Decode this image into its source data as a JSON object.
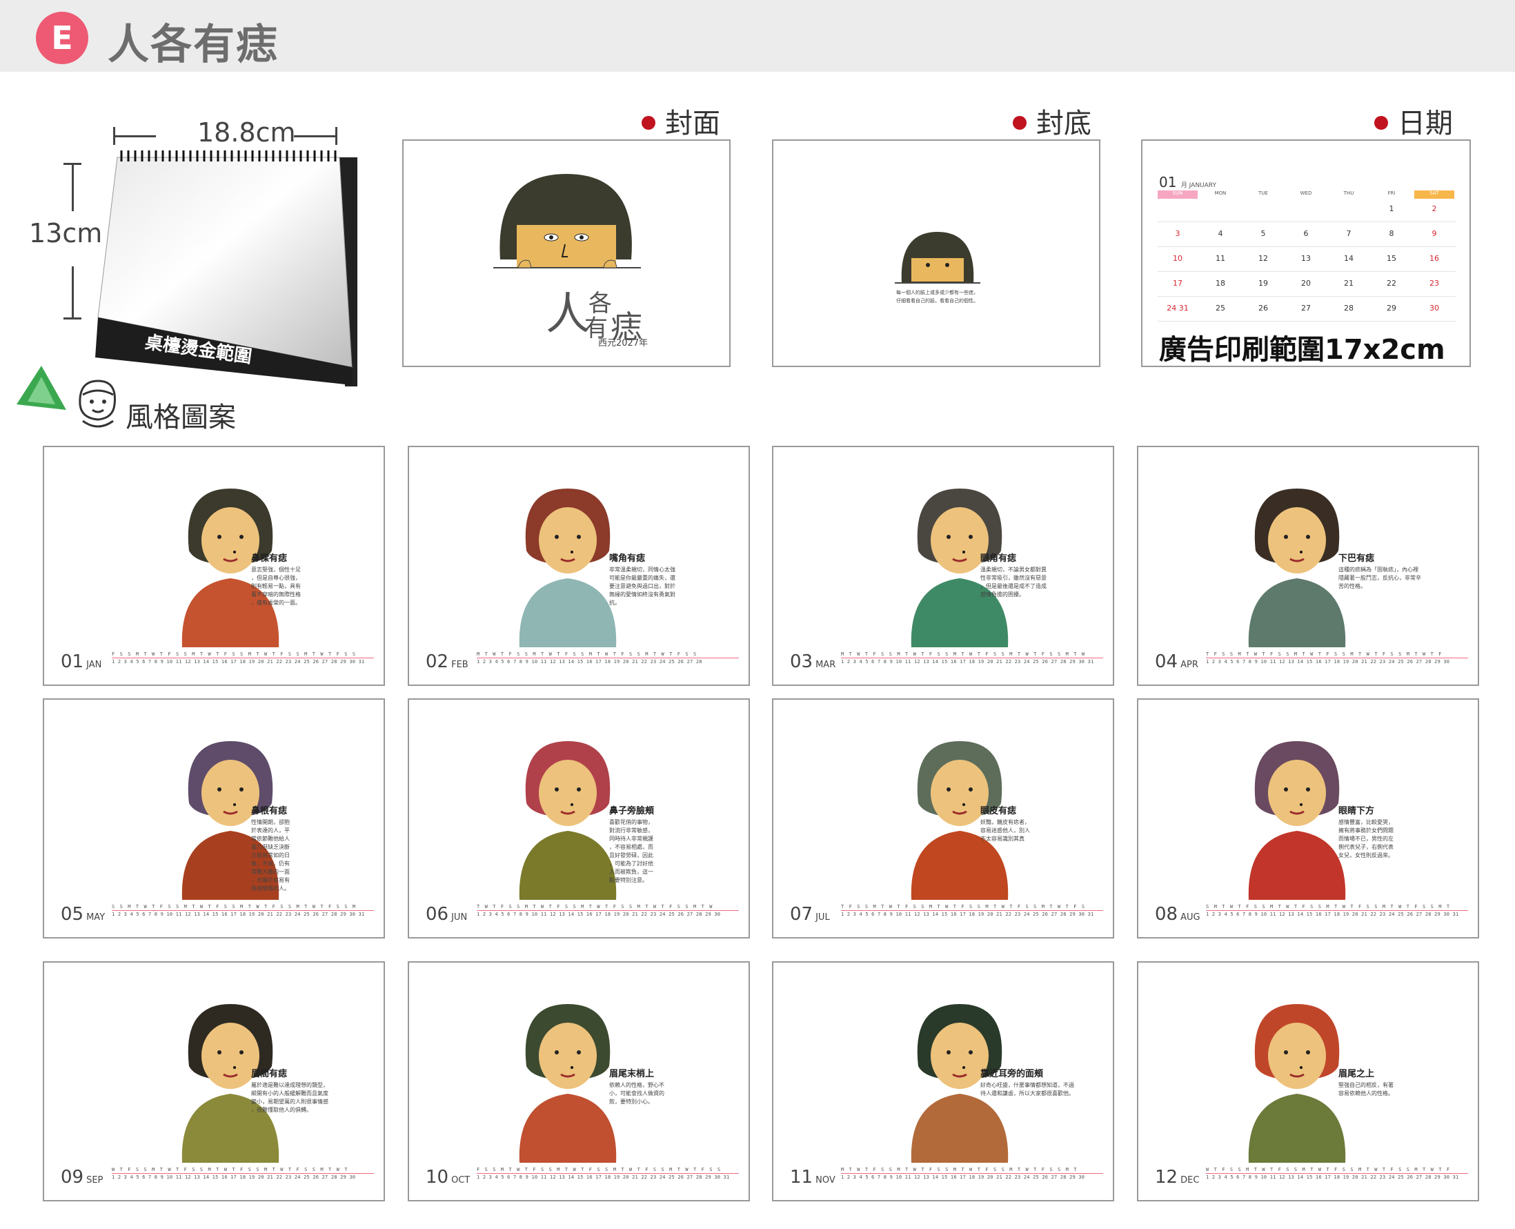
{
  "header": {
    "badge": "E",
    "title": "人各有痣"
  },
  "mockup": {
    "width_label": "18.8cm",
    "height_label": "13cm",
    "gold_area": "桌檯燙金範圍"
  },
  "style_label": "風格圖案",
  "sections": {
    "cover": {
      "label": "封面",
      "title_big": "人",
      "title_a": "各",
      "title_b": "有",
      "title_c": "痣",
      "year": "西元2027年"
    },
    "back": {
      "label": "封底",
      "text": "每一個人的臉上或多或少都有一些痣，\n仔細看看自己的臉，看看自己的個性。"
    },
    "dates": {
      "label": "日期",
      "month_num": "01",
      "month_sub": "月 JANUARY",
      "weekdays": [
        "SUN",
        "MON",
        "TUE",
        "WED",
        "THU",
        "FRI",
        "SAT"
      ],
      "rows": [
        [
          "",
          "",
          "",
          "",
          "",
          "1",
          "2"
        ],
        [
          "3",
          "4",
          "5",
          "6",
          "7",
          "8",
          "9"
        ],
        [
          "10",
          "11",
          "12",
          "13",
          "14",
          "15",
          "16"
        ],
        [
          "17",
          "18",
          "19",
          "20",
          "21",
          "22",
          "23"
        ],
        [
          "24 31",
          "25",
          "26",
          "27",
          "28",
          "29",
          "30"
        ]
      ],
      "ad_text": "廣告印刷範圍17x2cm"
    }
  },
  "months": [
    {
      "num": "01",
      "abbr": "JAN",
      "title": "鼻樑有痣",
      "text": "意志堅強，個性十足\n，但是自尊心很強，\n則有輕易一點，具有\n看不穿暗的無際性格\n，還有虛榮的一面。",
      "days": "F S S M T W T F S S M T W T F S S M T W T F S S M T W T F S S",
      "nums": "1 2 3 4 5 6 7 8 9 10 11 12 13 14 15 16 17 18 19 20 21 22 23 24 25 26 27 28 29 30 31",
      "hair": "#3b3a2c",
      "body": "#c5532f"
    },
    {
      "num": "02",
      "abbr": "FEB",
      "title": "嘴角有痣",
      "text": "非常溫柔親切，同情心太強\n可能是你最嚴重的痛失，還\n要注意避免與過口出，對於\n無緣的愛情如終沒有勇氣對\n抗。",
      "days": "M T W T F S S M T W T F S S M T W T F S S M T W T F S S",
      "nums": "1 2 3 4 5 6 7 8 9 10 11 12 13 14 15 16 17 18 19 20 21 22 23 24 25 26 27 28",
      "hair": "#8c3a2a",
      "body": "#8fb6b3"
    },
    {
      "num": "03",
      "abbr": "MAR",
      "title": "眼角有痣",
      "text": "溫柔親切，不論男女都對異\n性非常吸引，雖然沒有惡意\n，但是最後還是成不了造成\n感情負擔的困擾。",
      "days": "M T W T F S S M T W T F S S M T W T F S S M T W T F S S M T W",
      "nums": "1 2 3 4 5 6 7 8 9 10 11 12 13 14 15 16 17 18 19 20 21 22 23 24 25 26 27 28 29 30 31",
      "hair": "#4a4640",
      "body": "#3f8a66"
    },
    {
      "num": "04",
      "abbr": "APR",
      "title": "下巴有痣",
      "text": "這種的痣稱為「固執痣」，內心裡\n隱藏著一股鬥志，反抗心，非常辛\n苦的性格。",
      "days": "T F S S M T W T F S S M T W T F S S M T W T F S S M T W T F",
      "nums": "1 2 3 4 5 6 7 8 9 10 11 12 13 14 15 16 17 18 19 20 21 22 23 24 25 26 27 28 29 30",
      "hair": "#3a2e24",
      "body": "#5e7a6c"
    },
    {
      "num": "05",
      "abbr": "MAY",
      "title": "鼻根有痣",
      "text": "性情開朗，卻抱\n於表達的人，平\n常依節難他給人\n喜乃但缺乏決斷\n力容易常如的日\n後，不過，仍有\n常難大膽的一面\n，也屬於容易有\n與感情傷的人。",
      "days": "S S M T W T F S S M T W T F S S M T W T F S S M T W T F S S M",
      "nums": "1 2 3 4 5 6 7 8 9 10 11 12 13 14 15 16 17 18 19 20 21 22 23 24 25 26 27 28 29 30 31",
      "hair": "#5e4c6a",
      "body": "#a8401f"
    },
    {
      "num": "06",
      "abbr": "JUN",
      "title": "鼻子旁臉頰",
      "text": "喜歡花俏的事物，\n對流行非常敏感，\n同時待人非常親護\n，不容易相處，而\n且好發勞碌，因此\n，可能為了討好他\n人而被欺負，這一\n點要特別注意。",
      "days": "T W T F S S M T W T F S S M T W T F S S M T W T F S S M T W",
      "nums": "1 2 3 4 5 6 7 8 9 10 11 12 13 14 15 16 17 18 19 20 21 22 23 24 25 26 27 28 29 30",
      "hair": "#b0414a",
      "body": "#7a7a2a"
    },
    {
      "num": "07",
      "abbr": "JUL",
      "title": "眼皮有痣",
      "text": "妖豔，饑皮有痣者，\n容易迷惑他人，別人\n不太容易識別其真",
      "days": "T F S S M T W T F S S M T W T F S S M T W T F S S M T W T F S",
      "nums": "1 2 3 4 5 6 7 8 9 10 11 12 13 14 15 16 17 18 19 20 21 22 23 24 25 26 27 28 29 30 31",
      "hair": "#5d6d5a",
      "body": "#c0471f"
    },
    {
      "num": "08",
      "abbr": "AUG",
      "title": "眼睛下方",
      "text": "感情豐富，比較愛哭，\n擁有將事務於女們問題\n而情場不已，男性的左\n側代表兒子，右側代表\n女兒，女性則反過來。",
      "days": "S M T W T F S S M T W T F S S M T W T F S S M T W T F S S M T",
      "nums": "1 2 3 4 5 6 7 8 9 10 11 12 13 14 15 16 17 18 19 20 21 22 23 24 25 26 27 28 29 30 31",
      "hair": "#6a4a60",
      "body": "#c2352a"
    },
    {
      "num": "09",
      "abbr": "SEP",
      "title": "眉間有痣",
      "text": "屬於適是難以達成理想的類型，\n縱開有小的人般緩解難而且氣度\n變小，易期望萬的人則很事情感\n，很難懂取他人的俱轉。",
      "days": "W T F S S M T W T F S S M T W T F S S M T W T F S S M T W T",
      "nums": "1 2 3 4 5 6 7 8 9 10 11 12 13 14 15 16 17 18 19 20 21 22 23 24 25 26 27 28 29 30",
      "hair": "#2e2a22",
      "body": "#8a8a3a"
    },
    {
      "num": "10",
      "abbr": "OCT",
      "title": "眉尾末梢上",
      "text": "依賴人的性格，野心不\n小，可能會找人做資的\n款，要特別小心。",
      "days": "F S S M T W T F S S M T W T F S S M T W T F S S M T W T F S S",
      "nums": "1 2 3 4 5 6 7 8 9 10 11 12 13 14 15 16 17 18 19 20 21 22 23 24 25 26 27 28 29 30 31",
      "hair": "#3c4a30",
      "body": "#c05030"
    },
    {
      "num": "11",
      "abbr": "NOV",
      "title": "靠近耳旁的面頰",
      "text": "好奇心旺盛，什麼事情都想知道，不過\n待人還和謙虛，所以大家都很喜歡他。",
      "days": "M T W T F S S M T W T F S S M T W T F S S M T W T F S S M T",
      "nums": "1 2 3 4 5 6 7 8 9 10 11 12 13 14 15 16 17 18 19 20 21 22 23 24 25 26 27 28 29 30",
      "hair": "#2a3a2a",
      "body": "#b36a3a"
    },
    {
      "num": "12",
      "abbr": "DEC",
      "title": "眉尾之上",
      "text": "堅強自己的相反，有著\n容易依賴他人的性格。",
      "days": "W T F S S M T W T F S S M T W T F S S M T W T F S S M T W T F",
      "nums": "1 2 3 4 5 6 7 8 9 10 11 12 13 14 15 16 17 18 19 20 21 22 23 24 25 26 27 28 29 30 31",
      "hair": "#c0462a",
      "body": "#6c7a3a"
    }
  ]
}
